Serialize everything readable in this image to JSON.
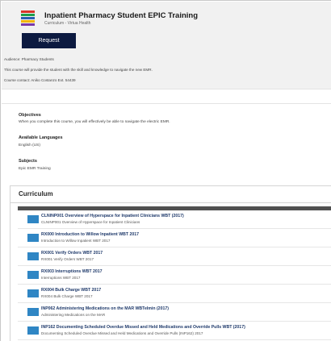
{
  "course": {
    "title": "Inpatient Pharmacy Student EPIC Training",
    "subtitle": "Curriculum  -  Virtua Health",
    "request_label": "Request",
    "audience": "Audience: Pharmacy Students",
    "description": "This course will provide the student with the skill and knowledge to navigate the new EMR.",
    "contact": "Course contact: Aniko Costanzo Ext. 54439"
  },
  "colors": {
    "accent": "#0c1a40",
    "item_icon": "#2f86c4",
    "icon_stripes": [
      "#d9342b",
      "#1e9e4a",
      "#2b5fb4",
      "#f0b400",
      "#7a3aa8"
    ]
  },
  "details": {
    "objectives_label": "Objectives",
    "objectives_text": "When you complete this course, you will effectively be able to navigate the electric EMR.",
    "languages_label": "Available Languages",
    "languages_value": "English (US)",
    "subjects_label": "Subjects",
    "subjects_value": "Epic EMR Training"
  },
  "curriculum": {
    "heading": "Curriculum",
    "items": [
      {
        "title": "CLNINP001 Overview of Hyperspace for Inpatient Clinicians WBT (2017)",
        "desc": "CLNINP001 Overview of Hyperspace for Inpatient Clinicians"
      },
      {
        "title": "RX000 Introduction to Willow Inpatient WBT 2017",
        "desc": "Introduction to Willow Inpatient WBT 2017"
      },
      {
        "title": "RX001 Verify Orders WBT 2017",
        "desc": "RX001 Verify Orders WBT 2017"
      },
      {
        "title": "RX003 Interruptions WBT 2017",
        "desc": "Interruptions WBT 2017"
      },
      {
        "title": "RX004 Bulk Charge WBT 2017",
        "desc": "RX004 Bulk Charge WBT 2017"
      },
      {
        "title": "INP062 Administering Medications on the MAR WBTelmin (2017)",
        "desc": "Administering Medications on the MAR"
      },
      {
        "title": "INP162 Documenting Scheduled Overdue Missed and Held Medications and Override Pulls WBT (2017)",
        "desc": "Documenting Scheduled Overdue Missed and Held Medications and Override Pulls (INP162) 2017"
      }
    ]
  }
}
